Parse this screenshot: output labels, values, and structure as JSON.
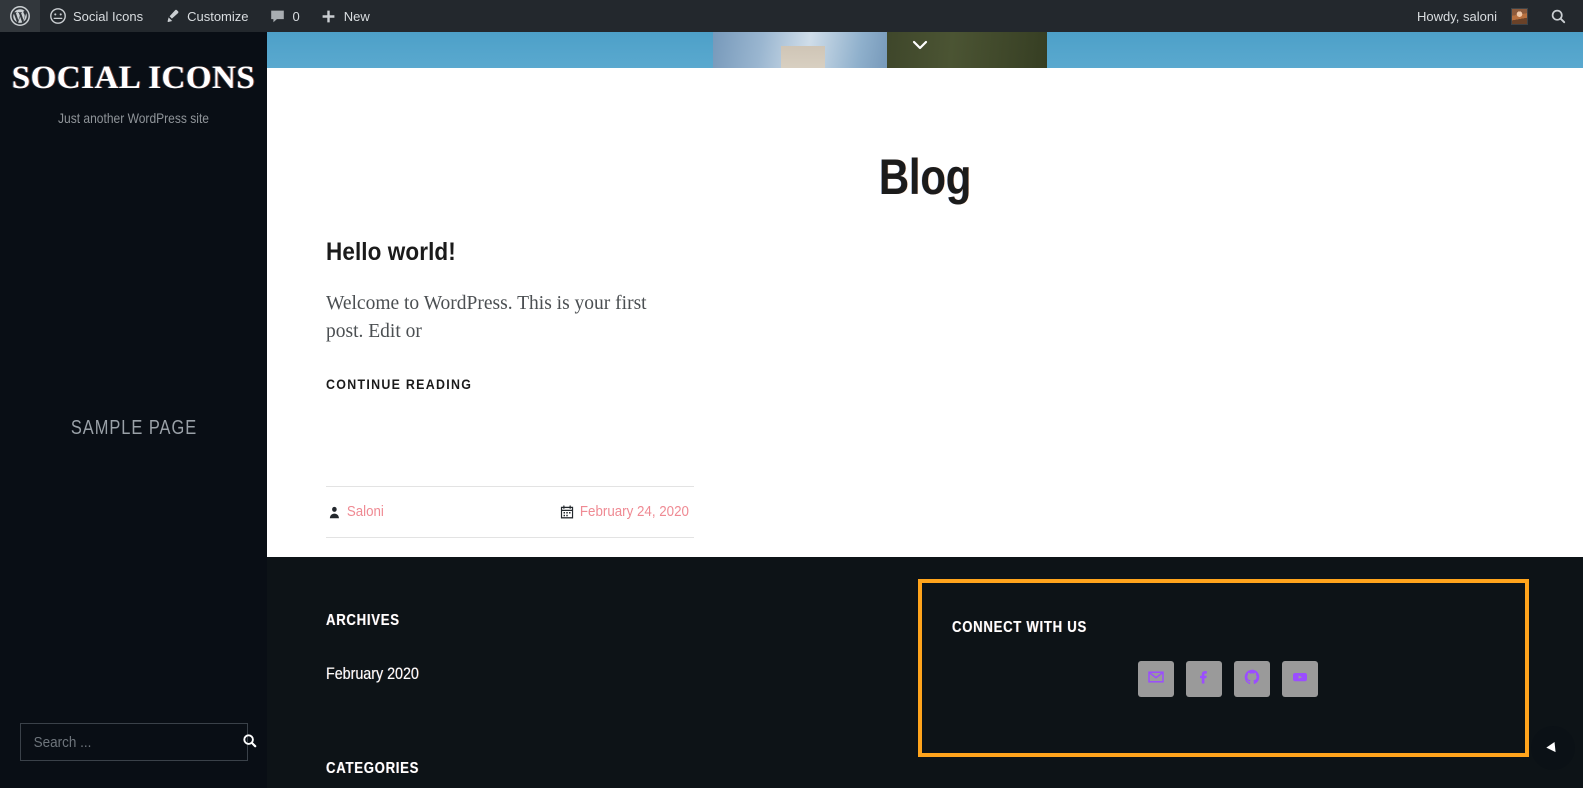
{
  "adminbar": {
    "wp_logo": "wordpress-logo-icon",
    "items": [
      {
        "label": "Social Icons",
        "icon": "dashboard-icon"
      },
      {
        "label": "Customize",
        "icon": "paintbrush-icon"
      },
      {
        "label": "0",
        "icon": "comment-bubble-icon"
      },
      {
        "label": "New",
        "icon": "plus-icon"
      }
    ],
    "howdy": "Howdy, saloni",
    "search_icon": "search-icon"
  },
  "sidebar": {
    "site_title": "SOCIAL ICONS",
    "tagline": "Just another WordPress site",
    "nav": [
      {
        "label": "Sample Page"
      }
    ],
    "search": {
      "placeholder": "Search ...",
      "value": "",
      "button_icon": "search-icon"
    }
  },
  "header_image": {
    "scroll_icon": "chevron-down-icon"
  },
  "main": {
    "page_title": "Blog",
    "post": {
      "title": "Hello world!",
      "excerpt": "Welcome to WordPress. This is your first post. Edit or",
      "continue_label": "Continue reading",
      "author": "Saloni",
      "author_icon": "user-icon",
      "date": "February 24, 2020",
      "date_icon": "calendar-icon"
    }
  },
  "footer": {
    "archives": {
      "title": "Archives",
      "links": [
        "February 2020"
      ]
    },
    "categories": {
      "title": "Categories"
    },
    "connect": {
      "title": "Connect with us",
      "socials": [
        {
          "name": "email-icon"
        },
        {
          "name": "facebook-icon"
        },
        {
          "name": "github-icon"
        },
        {
          "name": "youtube-icon"
        }
      ]
    }
  },
  "float_button": {
    "icon": "cursor-arrow-icon"
  },
  "colors": {
    "adminbar_bg": "#23282d",
    "sidebar_bg": "#090e15",
    "footer_bg": "#0d1317",
    "highlight_border": "#ffa41c",
    "link_pink": "#ef8a93",
    "social_glyph": "#9b4dff",
    "social_tile": "#9a9a9a",
    "header_blue": "#4da0c8"
  }
}
